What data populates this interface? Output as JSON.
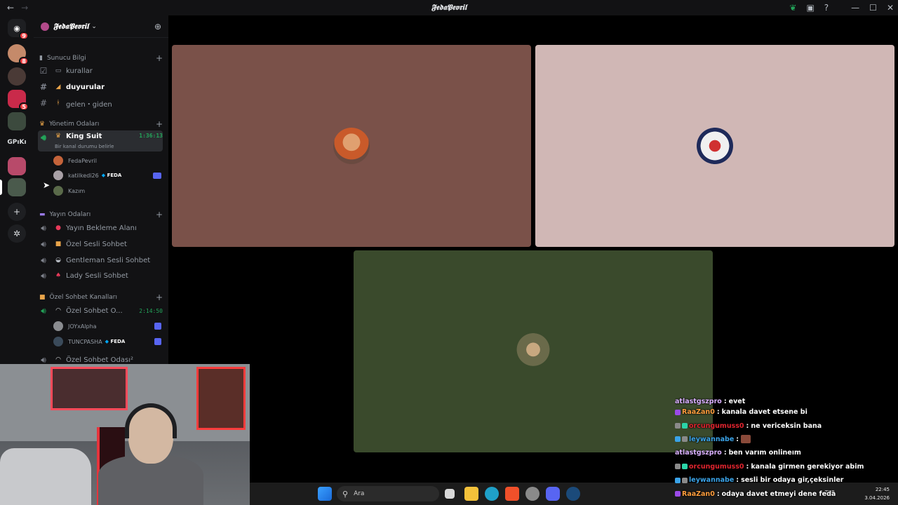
{
  "window": {
    "title": "𝕱𝖊𝖉𝖆𝕻𝖊𝖛𝖗𝖎𝖑",
    "back_icon": "←",
    "forward_icon": "→"
  },
  "servers": [
    {
      "badge": "9"
    },
    {
      "badge": "8"
    },
    {
      "badge": ""
    },
    {
      "badge": "5"
    },
    {
      "badge": ""
    },
    {
      "label": "GPıKı"
    },
    {
      "badge": ""
    },
    {
      "badge": ""
    }
  ],
  "guild": {
    "name": "𝕱𝖊𝖉𝖆𝕻𝖊𝖛𝖗𝖎𝖑"
  },
  "categories": {
    "sunucu": "Sunucu Bilgi",
    "yonetim": "Yönetim Odaları",
    "yayin": "Yayın Odaları",
    "ozel": "Özel Sohbet Kanalları"
  },
  "channels": {
    "kurallar": "kurallar",
    "duyurular": "duyurular",
    "gelen": "gelen・giden",
    "king": "King Suit",
    "king_timer": "1:36:13",
    "king_status": "Bir kanal durumu belirle",
    "yayin_bekleme": "Yayın Bekleme Alanı",
    "ozel_sesli": "Özel Sesli Sohbet",
    "gentleman": "Gentleman Sesli Sohbet",
    "lady": "Lady Sesli Sohbet",
    "ozel_odasi1": "Özel Sohbet O...",
    "ozel_timer": "2:14:50",
    "ozel_odasi2": "Özel Sohbet Odası²"
  },
  "voice_users": {
    "u1": "FedaPevril",
    "u2": "katilkedi26",
    "u2_tag": "FEDA",
    "u3": "Kazım",
    "u4": "JOYxAlpha",
    "u5": "TUNCPASHA",
    "u5_tag": "FEDA"
  },
  "taskbar": {
    "search_placeholder": "Ara",
    "lang": "TUR",
    "time": "22:45",
    "date": "3.04.2026"
  },
  "chat": [
    {
      "user": "atlastgszpro",
      "text": "evet",
      "color": "#d9b0ff"
    },
    {
      "user": "RaaZan0",
      "text": "kanala davet etsene bi",
      "color": "#ff9e3d"
    },
    {
      "user": "orcungumuss0",
      "text": "ne vericeksin bana",
      "color": "#e0242e"
    },
    {
      "user": "leywannabe",
      "text": "",
      "color": "#3aa3e8"
    },
    {
      "user": "atlastgszpro",
      "text": "ben varım onlineım",
      "color": "#d9b0ff"
    },
    {
      "user": "orcungumuss0",
      "text": "kanala girmen gerekiyor abim",
      "color": "#e0242e"
    },
    {
      "user": "leywannabe",
      "text": "sesli bir odaya gir,çeksinler",
      "color": "#3aa3e8"
    },
    {
      "user": "RaaZan0",
      "text": "odaya davet etmeyi dene feda",
      "color": "#ff9e3d"
    }
  ],
  "colors": {
    "tile1": "#7a5149",
    "tile2": "#d0b7b5",
    "tile3": "#3a4a2c",
    "accent": "#5865f2",
    "voice_green": "#23a55a"
  }
}
